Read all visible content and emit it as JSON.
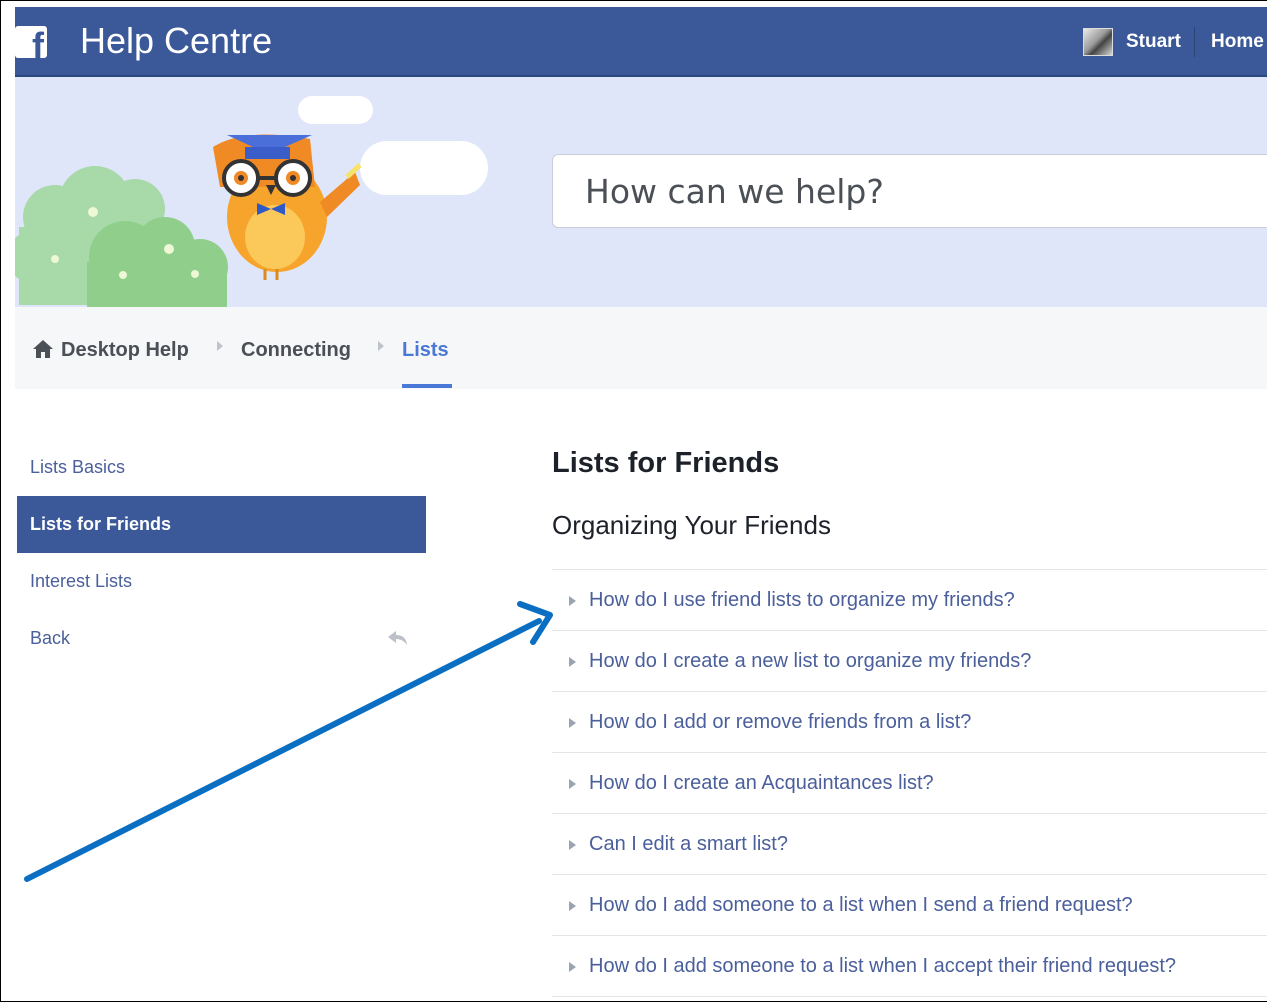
{
  "header": {
    "app_title": "Help Centre",
    "logo_letter": "f",
    "user_name": "Stuart",
    "home_label": "Home"
  },
  "hero": {
    "search_placeholder": "How can we help?"
  },
  "breadcrumb": {
    "items": [
      "Desktop Help",
      "Connecting",
      "Lists"
    ]
  },
  "sidebar": {
    "items": [
      {
        "label": "Lists Basics"
      },
      {
        "label": "Lists for Friends"
      },
      {
        "label": "Interest Lists"
      },
      {
        "label": "Back"
      }
    ],
    "active_item": "Lists for Friends"
  },
  "main": {
    "title": "Lists for Friends",
    "section_title": "Organizing Your Friends",
    "questions": [
      "How do I use friend lists to organize my friends?",
      "How do I create a new list to organize my friends?",
      "How do I add or remove friends from a list?",
      "How do I create an Acquaintances list?",
      "Can I edit a smart list?",
      "How do I add someone to a list when I send a friend request?",
      "How do I add someone to a list when I accept their friend request?"
    ]
  },
  "icons": {
    "logo": "facebook-logo-icon",
    "home": "house-icon",
    "back": "reply-arrow-icon",
    "faq_bullet": "triangle-right-icon",
    "breadcrumb_separator": "triangle-right-icon",
    "mascot": "owl-mascot-illustration"
  },
  "colors": {
    "brand_blue": "#3b5998",
    "link_blue": "#4a5f9b",
    "active_crumb": "#4a78d6",
    "hero_background": "#dfe6f9",
    "annotation_arrow": "#0a6fc2"
  }
}
